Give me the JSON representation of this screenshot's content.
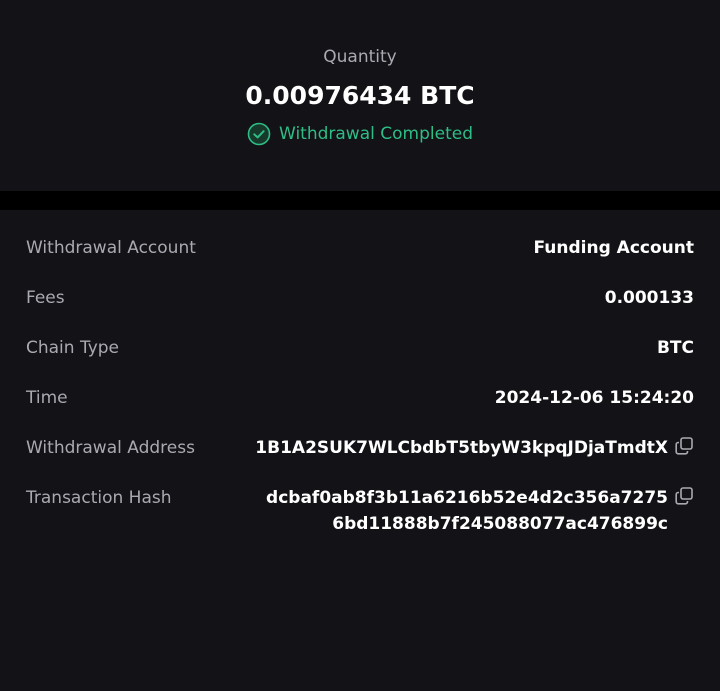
{
  "summary": {
    "quantity_label": "Quantity",
    "quantity_value": "0.00976434 BTC",
    "status_text": "Withdrawal Completed",
    "status_icon": "check-circle-icon"
  },
  "details": {
    "withdrawal_account": {
      "label": "Withdrawal Account",
      "value": "Funding Account"
    },
    "fees": {
      "label": "Fees",
      "value": "0.000133"
    },
    "chain_type": {
      "label": "Chain Type",
      "value": "BTC"
    },
    "time": {
      "label": "Time",
      "value": "2024-12-06 15:24:20"
    },
    "withdrawal_address": {
      "label": "Withdrawal Address",
      "value": "1B1A2SUK7WLCbdbT5tbyW3kpqJDjaTmdtX",
      "icon": "copy-icon"
    },
    "transaction_hash": {
      "label": "Transaction Hash",
      "value_line1": "dcbaf0ab8f3b11a6216b52e4d2c356a7275",
      "value_line2": "6bd11888b7f245088077ac476899c",
      "icon": "copy-icon"
    }
  },
  "colors": {
    "background": "#121217",
    "divider": "#000000",
    "label": "#a9a9b1",
    "value": "#ffffff",
    "success": "#2ebd85"
  }
}
